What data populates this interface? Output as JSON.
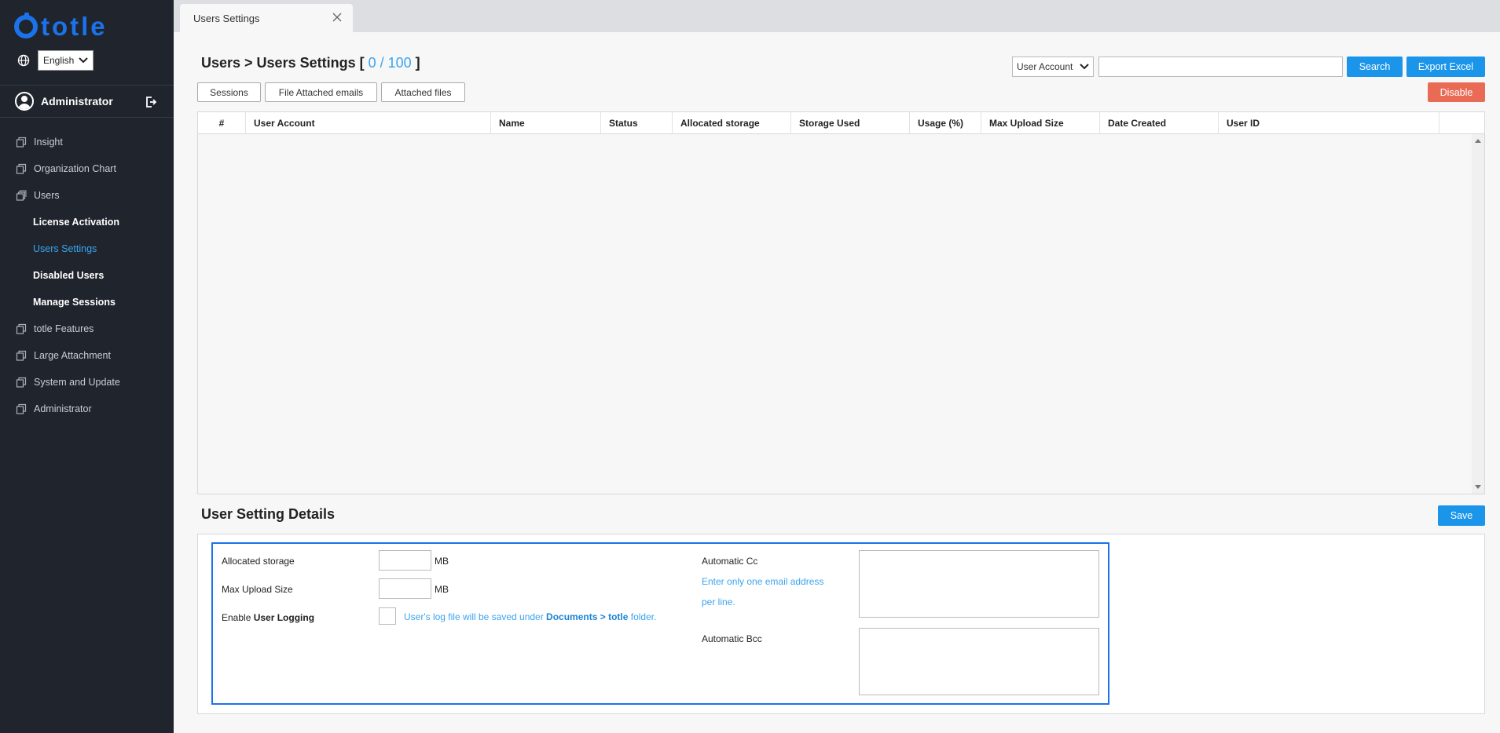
{
  "sidebar": {
    "logo_text": "totle",
    "language": "English",
    "user_name": "Administrator",
    "nav_items": [
      {
        "label": "Insight"
      },
      {
        "label": "Organization Chart"
      },
      {
        "label": "Users"
      }
    ],
    "sub_items": [
      {
        "label": "License Activation"
      },
      {
        "label": "Users Settings"
      },
      {
        "label": "Disabled Users"
      },
      {
        "label": "Manage Sessions"
      }
    ],
    "nav_items_after": [
      {
        "label": "totle Features"
      },
      {
        "label": "Large Attachment"
      },
      {
        "label": "System and Update"
      },
      {
        "label": "Administrator"
      }
    ]
  },
  "tab": {
    "label": "Users Settings"
  },
  "header": {
    "title": "Users > Users Settings [",
    "count": " 0 / 100 ",
    "title_end": "]"
  },
  "search": {
    "field": "User Account",
    "value": "",
    "search_label": "Search",
    "export_label": "Export Excel"
  },
  "toolbar": {
    "sessions_label": "Sessions",
    "file_attached_label": "File Attached emails",
    "attached_files_label": "Attached files",
    "disable_label": "Disable"
  },
  "grid": {
    "columns": [
      "#",
      "User Account",
      "Name",
      "Status",
      "Allocated storage",
      "Storage Used",
      "Usage (%)",
      "Max Upload Size",
      "Date Created",
      "User ID"
    ],
    "rows": []
  },
  "details": {
    "title": "User Setting Details",
    "save_label": "Save",
    "allocated_label": "Allocated storage",
    "allocated_unit": "MB",
    "max_upload_label": "Max Upload Size",
    "max_upload_unit": "MB",
    "logging_prefix": "Enable ",
    "logging_bold": "User Logging",
    "logging_hint_pre": "User's log file will be saved under ",
    "logging_hint_bold": "Documents > totle",
    "logging_hint_post": " folder.",
    "cc_label": "Automatic Cc",
    "cc_hint_line1": "Enter only one email address",
    "cc_hint_line2": "per line.",
    "bcc_label": "Automatic Bcc"
  },
  "colors": {
    "sidebar_bg": "#20252d",
    "accent": "#1a95ea",
    "danger": "#ea6b55",
    "brand": "#1b72ea"
  }
}
